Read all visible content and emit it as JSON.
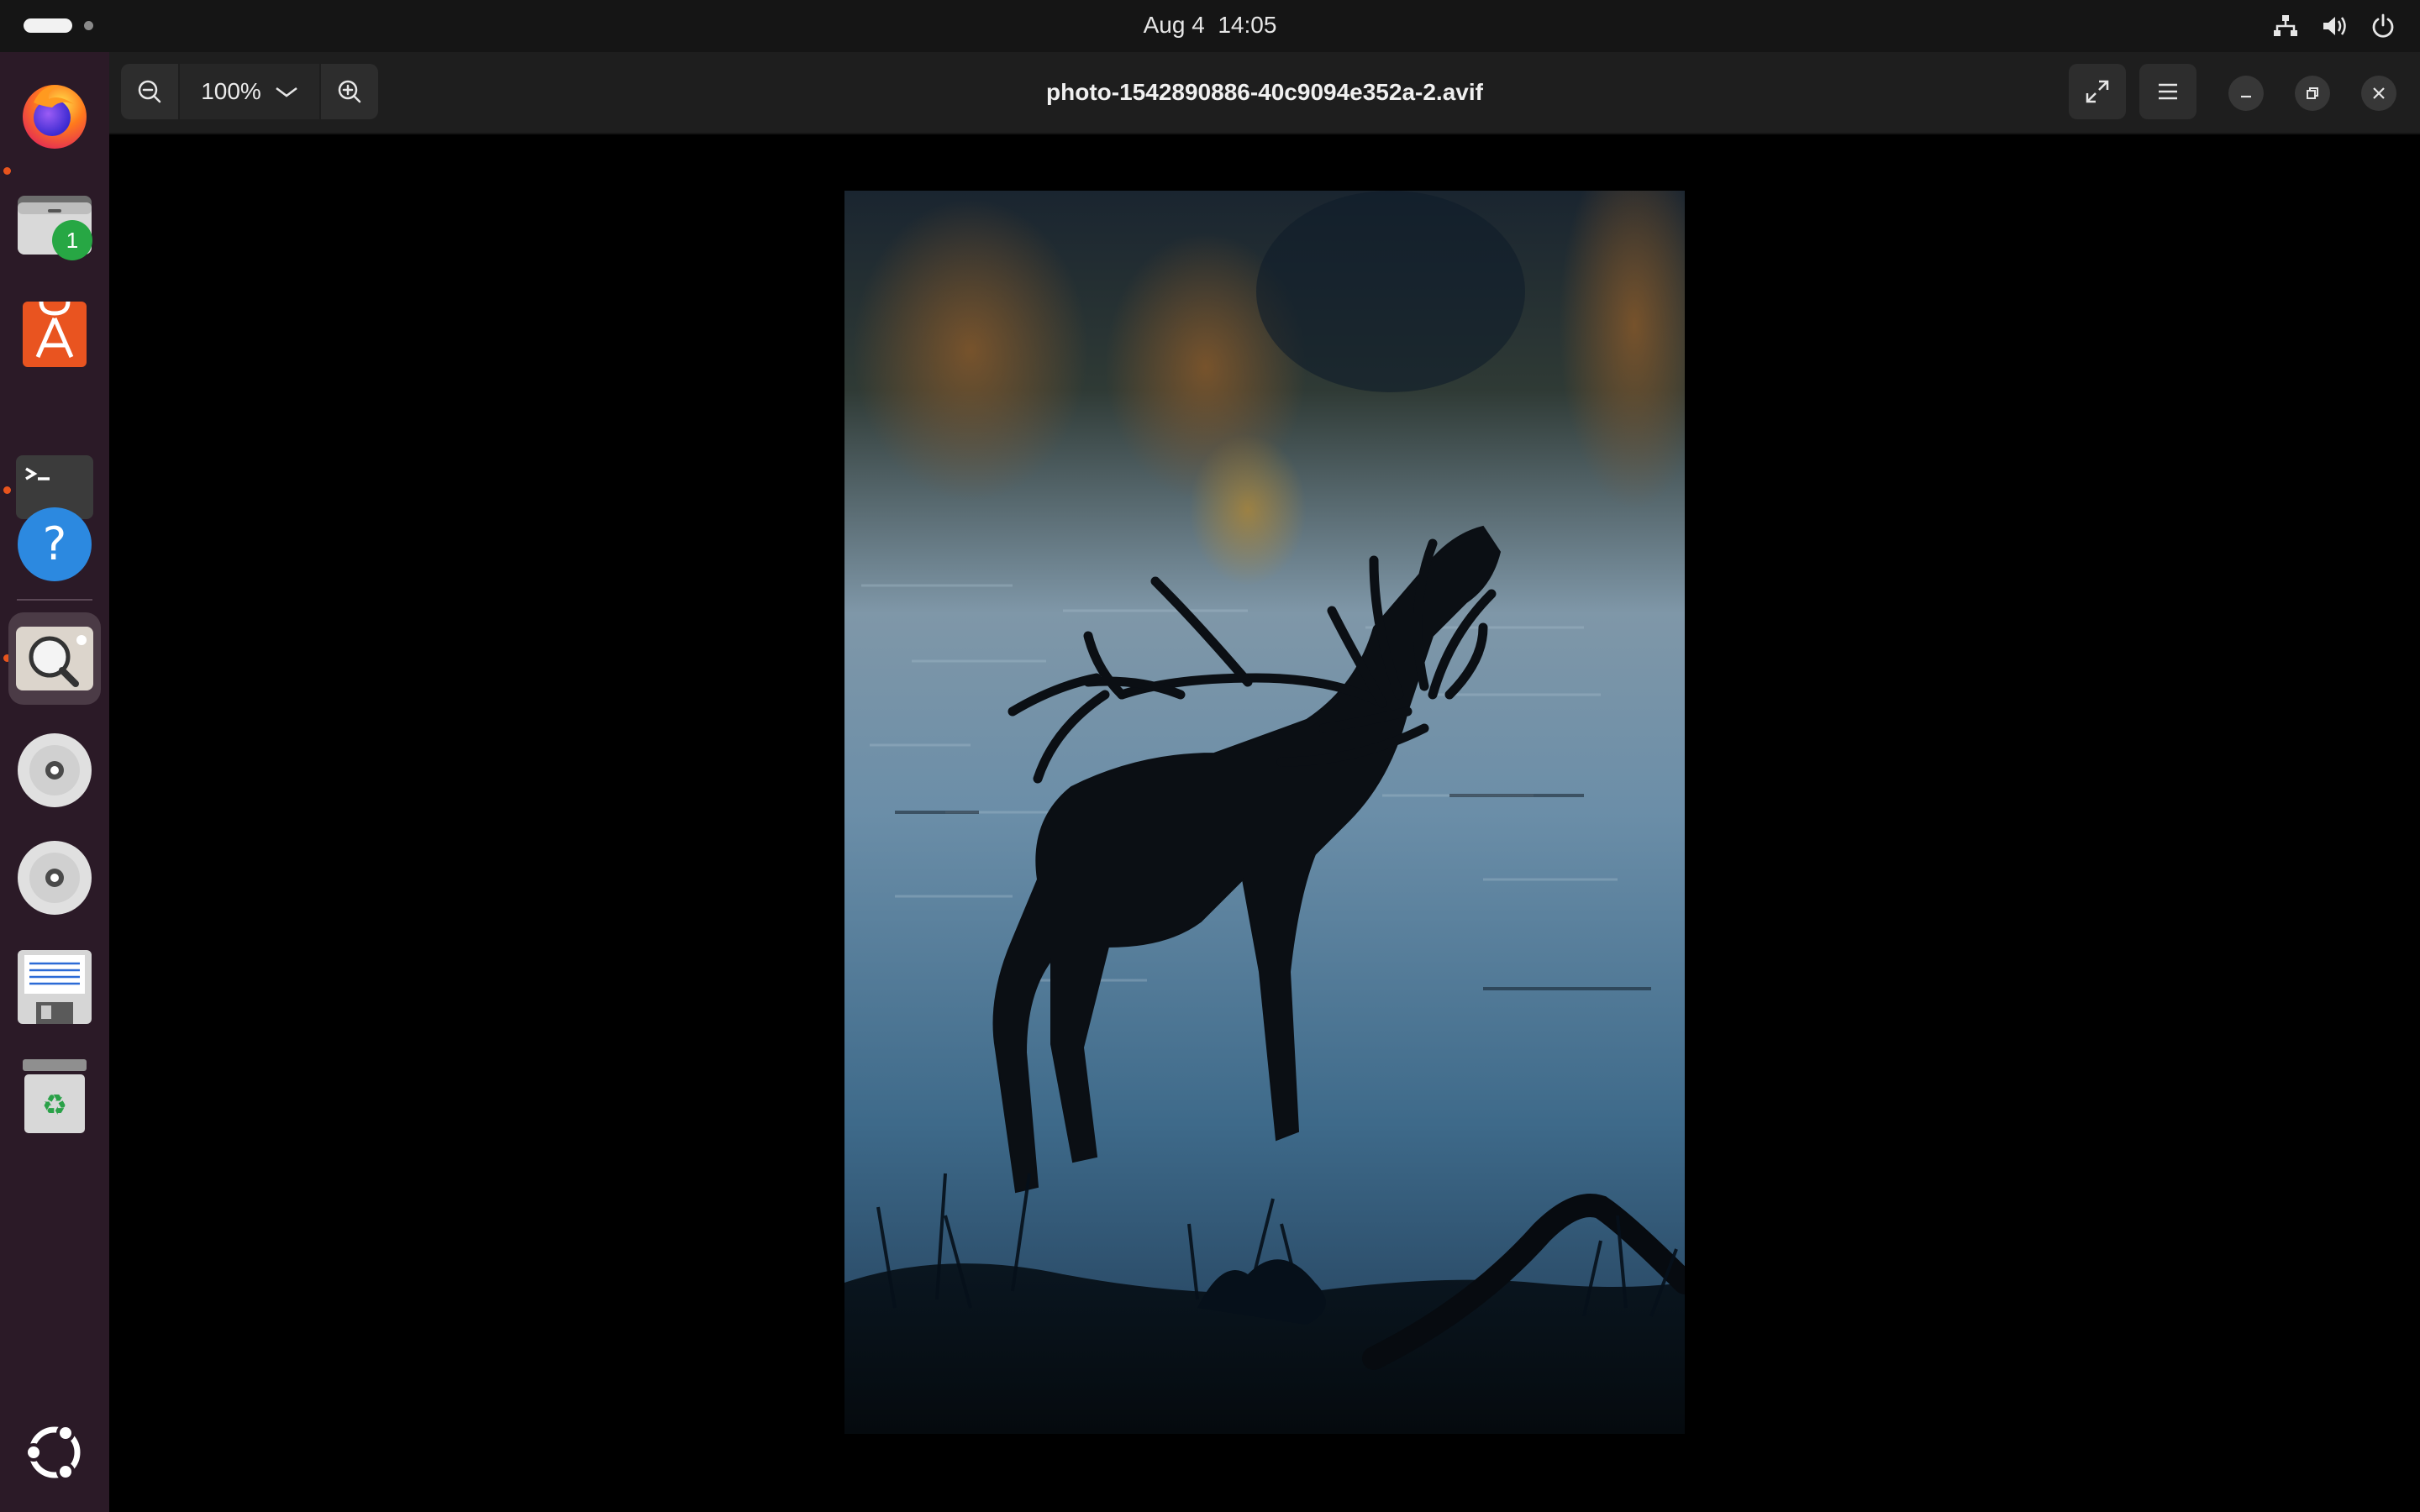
{
  "topbar": {
    "date": "Aug 4",
    "time": "14:05",
    "tray_icons": [
      "network-icon",
      "volume-icon",
      "power-icon"
    ]
  },
  "dock": {
    "apps": [
      {
        "name": "Firefox",
        "icon": "firefox-icon",
        "running": false
      },
      {
        "name": "Files",
        "icon": "files-icon",
        "running": true,
        "badge": "1"
      },
      {
        "name": "App Center",
        "icon": "app-center-icon",
        "running": false
      },
      {
        "name": "Terminal",
        "icon": "terminal-icon",
        "running": true
      },
      {
        "name": "Help",
        "icon": "help-icon",
        "running": false
      },
      {
        "name": "Image Viewer",
        "icon": "image-viewer-icon",
        "running": true,
        "active": true
      },
      {
        "name": "Disc 1",
        "icon": "disc-icon",
        "running": false
      },
      {
        "name": "Disc 2",
        "icon": "disc-icon",
        "running": false
      },
      {
        "name": "Save",
        "icon": "floppy-icon",
        "running": false
      },
      {
        "name": "Trash",
        "icon": "trash-icon",
        "running": false
      }
    ],
    "show_apps_icon": "ubuntu-logo-icon"
  },
  "viewer": {
    "zoom_level": "100%",
    "title": "photo-1542890886-40c9094e352a-2.avif",
    "buttons": [
      "zoom-out-icon",
      "zoom-in-icon",
      "fullscreen-icon",
      "menu-icon",
      "minimize-icon",
      "maximize-icon",
      "close-icon"
    ],
    "image_subject": "Silhouette of a stag bellowing in front of a lake"
  },
  "colors": {
    "topbar_bg": "#151515",
    "dock_bg": "#2b1a27",
    "header_bg": "#1e1e1e",
    "accent_running": "#e8541d",
    "badge": "#27a744"
  }
}
